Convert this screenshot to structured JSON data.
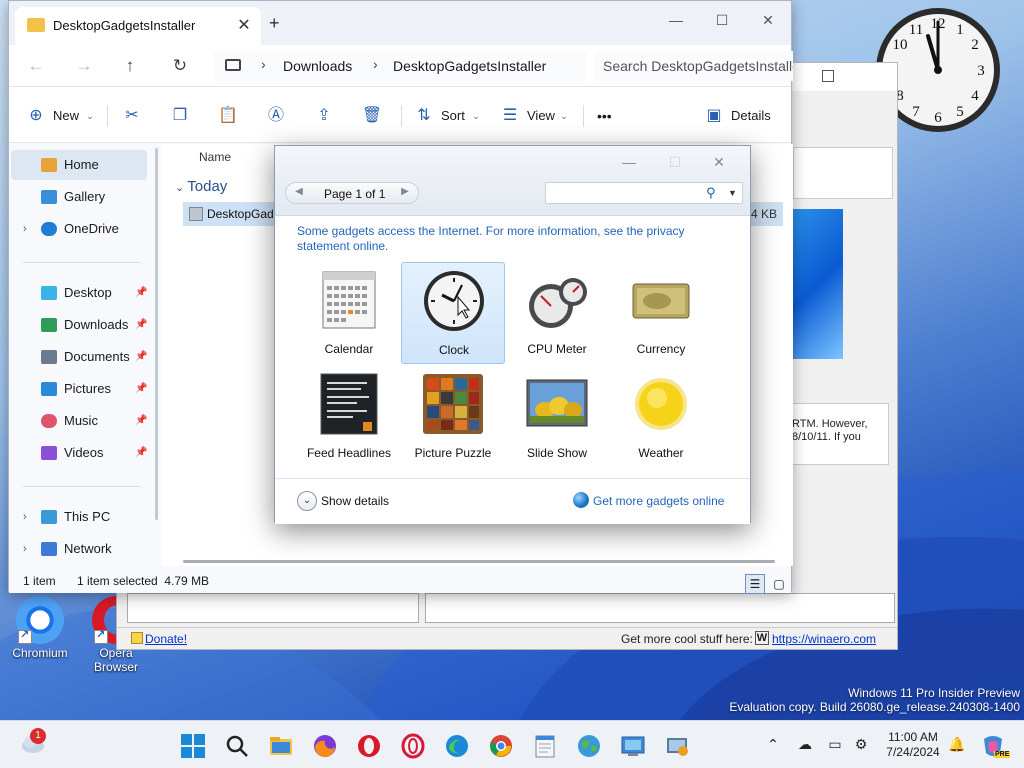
{
  "explorer": {
    "tab_title": "DesktopGadgetsInstaller",
    "breadcrumb": [
      "Downloads",
      "DesktopGadgetsInstaller"
    ],
    "search_placeholder": "Search DesktopGadgetsInstaller",
    "toolbar": {
      "new_label": "New",
      "sort_label": "Sort",
      "view_label": "View",
      "more_label": "•••",
      "details_label": "Details"
    },
    "nav": [
      {
        "label": "Home",
        "icon": "home-icon",
        "color": "#e8a23a",
        "selected": true
      },
      {
        "label": "Gallery",
        "icon": "gallery-icon",
        "color": "#3a8fd8"
      },
      {
        "label": "OneDrive",
        "icon": "onedrive-icon",
        "color": "#1f7fd6",
        "expandable": true
      },
      {
        "label": "Desktop",
        "icon": "desktop-icon",
        "color": "#3ab3e6",
        "pinned": true
      },
      {
        "label": "Downloads",
        "icon": "downloads-icon",
        "color": "#2f9b5a",
        "pinned": true
      },
      {
        "label": "Documents",
        "icon": "documents-icon",
        "color": "#6b7b90",
        "pinned": true
      },
      {
        "label": "Pictures",
        "icon": "pictures-icon",
        "color": "#2b8ad8",
        "pinned": true
      },
      {
        "label": "Music",
        "icon": "music-icon",
        "color": "#e0556b",
        "pinned": true
      },
      {
        "label": "Videos",
        "icon": "videos-icon",
        "color": "#8a4fd8",
        "pinned": true
      },
      {
        "label": "This PC",
        "icon": "this-pc-icon",
        "color": "#3a9ad8",
        "expandable": true
      },
      {
        "label": "Network",
        "icon": "network-icon",
        "color": "#3a7ad8",
        "expandable": true
      }
    ],
    "column_name": "Name",
    "group_label": "Today",
    "file": {
      "name": "DesktopGadg",
      "size": "4 KB"
    },
    "status": {
      "count": "1 item",
      "selected": "1 item selected  4.79 MB"
    }
  },
  "gadgets": {
    "pager_label": "Page 1 of 1",
    "info_text": "Some gadgets access the Internet.  For more information, see the privacy statement online.",
    "tiles": [
      {
        "label": "Calendar",
        "icon": "calendar-icon"
      },
      {
        "label": "Clock",
        "icon": "clock-icon",
        "selected": true
      },
      {
        "label": "CPU Meter",
        "icon": "cpu-meter-icon"
      },
      {
        "label": "Currency",
        "icon": "currency-icon"
      },
      {
        "label": "Feed Headlines",
        "icon": "feed-headlines-icon"
      },
      {
        "label": "Picture Puzzle",
        "icon": "picture-puzzle-icon"
      },
      {
        "label": "Slide Show",
        "icon": "slide-show-icon"
      },
      {
        "label": "Weather",
        "icon": "weather-icon"
      }
    ],
    "show_details": "Show details",
    "get_more": "Get more gadgets online"
  },
  "background_window": {
    "text_snippet": "RTM. However, 8/10/11. If you",
    "donate": "Donate!",
    "cool_stuff": "Get more cool stuff here:",
    "w_logo": "W",
    "link": "https://winaero.com"
  },
  "desktop": {
    "icons": [
      {
        "label": "Chromium"
      },
      {
        "label": "Opera Browser"
      }
    ],
    "watermark_line1": "Windows 11 Pro Insider Preview",
    "watermark_line2": "Evaluation copy. Build 26080.ge_release.240308-1400"
  },
  "taskbar": {
    "weather_badge": "1",
    "time": "11:00 AM",
    "date": "7/24/2024",
    "copilot_badge": "PRE"
  }
}
